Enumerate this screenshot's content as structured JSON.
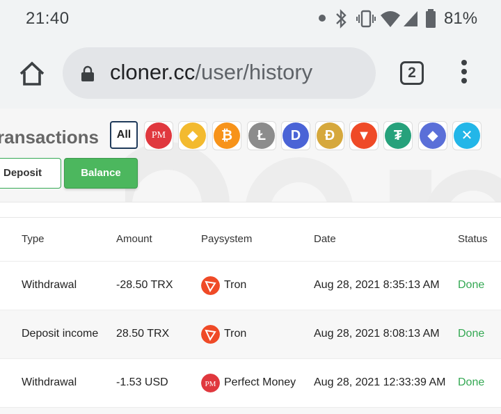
{
  "status_bar": {
    "time": "21:40",
    "battery": "81%",
    "icons": [
      "notification-dot-icon",
      "bluetooth-icon",
      "vibrate-icon",
      "wifi-icon",
      "signal-icon",
      "battery-icon"
    ]
  },
  "browser": {
    "url_host": "cloner.cc",
    "url_path": "/user/history",
    "tab_count": "2"
  },
  "page": {
    "title_fragment": "ransactions",
    "filter_all": "All",
    "currency_filters": [
      {
        "name": "perfect-money",
        "label": "PM",
        "color": "#e0383e"
      },
      {
        "name": "binance",
        "label": "◆",
        "color": "#f3ba2f"
      },
      {
        "name": "bitcoin",
        "label": "₿",
        "color": "#f7931a"
      },
      {
        "name": "litecoin",
        "label": "Ł",
        "color": "#8c8c8c"
      },
      {
        "name": "dash",
        "label": "D",
        "color": "#4a63d6"
      },
      {
        "name": "dogecoin",
        "label": "Ð",
        "color": "#d6a83c"
      },
      {
        "name": "tron",
        "label": "▼",
        "color": "#ef4a27"
      },
      {
        "name": "tether",
        "label": "₮",
        "color": "#26a17b"
      },
      {
        "name": "ethereum",
        "label": "◆",
        "color": "#5a6fd8"
      },
      {
        "name": "ripple",
        "label": "✕",
        "color": "#23b6e8"
      }
    ],
    "tabs": {
      "deposit": "Deposit",
      "balance": "Balance"
    }
  },
  "table": {
    "headers": {
      "type": "Type",
      "amount": "Amount",
      "paysystem": "Paysystem",
      "date": "Date",
      "status": "Status"
    },
    "rows": [
      {
        "type": "Withdrawal",
        "amount": "-28.50 TRX",
        "paysystem": "Tron",
        "pay_icon": "tron-icon",
        "date": "Aug 28, 2021 8:35:13 AM",
        "status": "Done"
      },
      {
        "type": "Deposit income",
        "amount": "28.50 TRX",
        "paysystem": "Tron",
        "pay_icon": "tron-icon",
        "date": "Aug 28, 2021 8:08:13 AM",
        "status": "Done"
      },
      {
        "type": "Withdrawal",
        "amount": "-1.53 USD",
        "paysystem": "Perfect Money",
        "pay_icon": "perfect-money-icon",
        "date": "Aug 28, 2021 12:33:39 AM",
        "status": "Done"
      }
    ]
  },
  "colors": {
    "accent_green": "#4cb75e",
    "status_done": "#34a853",
    "tron_red": "#ef4a27",
    "pm_red": "#e0383e"
  }
}
